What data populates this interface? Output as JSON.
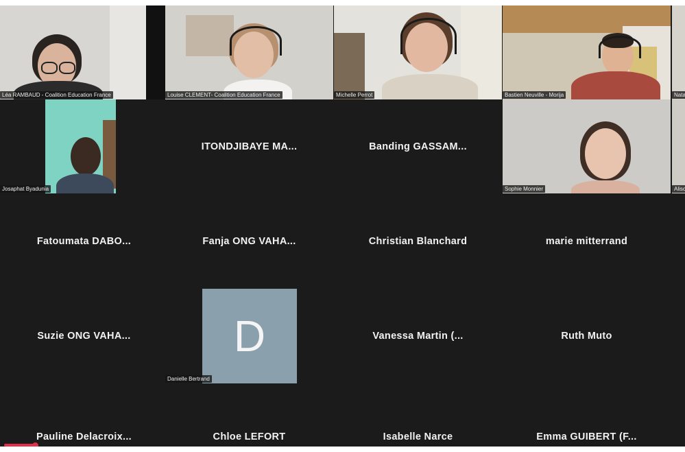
{
  "participants": {
    "video": [
      {
        "name": "Léa RAMBAUD - Coalition Education France"
      },
      {
        "name": "Louise CLEMENT- Coalition Education France"
      },
      {
        "name": "Michelle Perrot"
      },
      {
        "name": "Bastien Neuville - Morija"
      },
      {
        "name": "Nata"
      },
      {
        "name": "Josaphat Byadunia"
      },
      {
        "name": "Sophie Monnier"
      },
      {
        "name": "Alisc"
      }
    ],
    "audio_only": [
      "ITONDJIBAYE  MA...",
      "Banding  GASSAM...",
      "Fatoumata  DABO...",
      "Fanja ONG  VAHA...",
      "Christian Blanchard",
      "marie mitterrand",
      "Suzie ONG  VAHA...",
      "Vanessa  Martin  (...",
      "Ruth Muto",
      "Pauline  Delacroix...",
      "Chloe LEFORT",
      "Isabelle Narce",
      "Emma  GUIBERT  (F..."
    ],
    "avatar": {
      "letter": "D",
      "name": "Danielle Bertrand",
      "color": "#8aa0ad"
    }
  },
  "playback": {
    "progress_color": "#e0304a"
  }
}
